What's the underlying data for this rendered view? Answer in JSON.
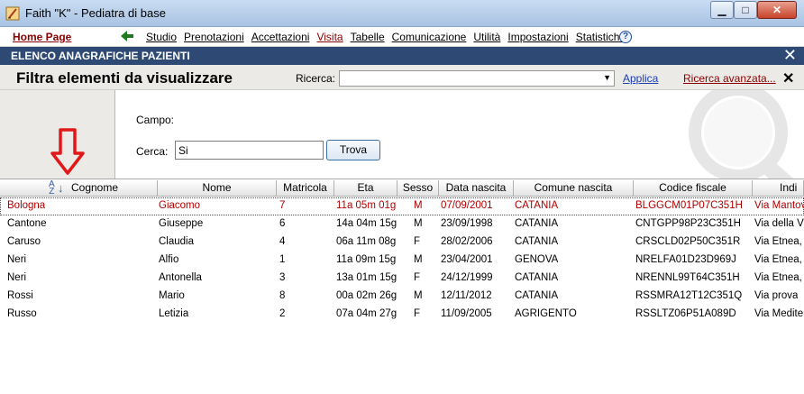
{
  "window": {
    "title": "Faith \"K\" - Pediatra di base",
    "min_label": "▁",
    "max_label": "□",
    "close_label": "✕"
  },
  "menu": {
    "home": "Home Page",
    "items": [
      "Studio",
      "Prenotazioni",
      "Accettazioni",
      "Visita",
      "Tabelle",
      "Comunicazione",
      "Utilità",
      "Impostazioni",
      "Statistiche"
    ],
    "active": "Visita",
    "help": "?"
  },
  "section": {
    "title": "ELENCO ANAGRAFICHE PAZIENTI",
    "close": "✕"
  },
  "filter": {
    "heading": "Filtra elementi da visualizzare",
    "ricerca_label": "Ricerca:",
    "ricerca_value": "",
    "applica": "Applica",
    "ricerca_avanzata": "Ricerca avanzata...",
    "close": "✕"
  },
  "search": {
    "campo_label": "Campo:",
    "cerca_label": "Cerca:",
    "cerca_value": "Si",
    "trova_label": "Trova"
  },
  "table": {
    "columns": [
      "Cognome",
      "Nome",
      "Matricola",
      "Eta",
      "Sesso",
      "Data nascita",
      "Comune nascita",
      "Codice fiscale",
      "Indi"
    ],
    "sorted_column": "Cognome",
    "rows": [
      [
        "Bologna",
        "Giacomo",
        "7",
        "11a 05m 01g",
        "M",
        "07/09/2001",
        "CATANIA",
        "BLGGCM01P07C351H",
        "Via Mantov"
      ],
      [
        "Cantone",
        "Giuseppe",
        "6",
        "14a 04m 15g",
        "M",
        "23/09/1998",
        "CATANIA",
        "CNTGPP98P23C351H",
        "Via della V"
      ],
      [
        "Caruso",
        "Claudia",
        "4",
        "06a 11m 08g",
        "F",
        "28/02/2006",
        "CATANIA",
        "CRSCLD02P50C351R",
        "Via Etnea,"
      ],
      [
        "Neri",
        "Alfio",
        "1",
        "11a 09m 15g",
        "M",
        "23/04/2001",
        "GENOVA",
        "NRELFA01D23D969J",
        "Via Etnea,"
      ],
      [
        "Neri",
        "Antonella",
        "3",
        "13a 01m 15g",
        "F",
        "24/12/1999",
        "CATANIA",
        "NRENNL99T64C351H",
        "Via Etnea,"
      ],
      [
        "Rossi",
        "Mario",
        "8",
        "00a 02m 26g",
        "M",
        "12/11/2012",
        "CATANIA",
        "RSSMRA12T12C351Q",
        "Via prova"
      ],
      [
        "Russo",
        "Letizia",
        "2",
        "07a 04m 27g",
        "F",
        "11/09/2005",
        "AGRIGENTO",
        "RSSLTZ06P51A089D",
        "Via Medite"
      ]
    ]
  }
}
